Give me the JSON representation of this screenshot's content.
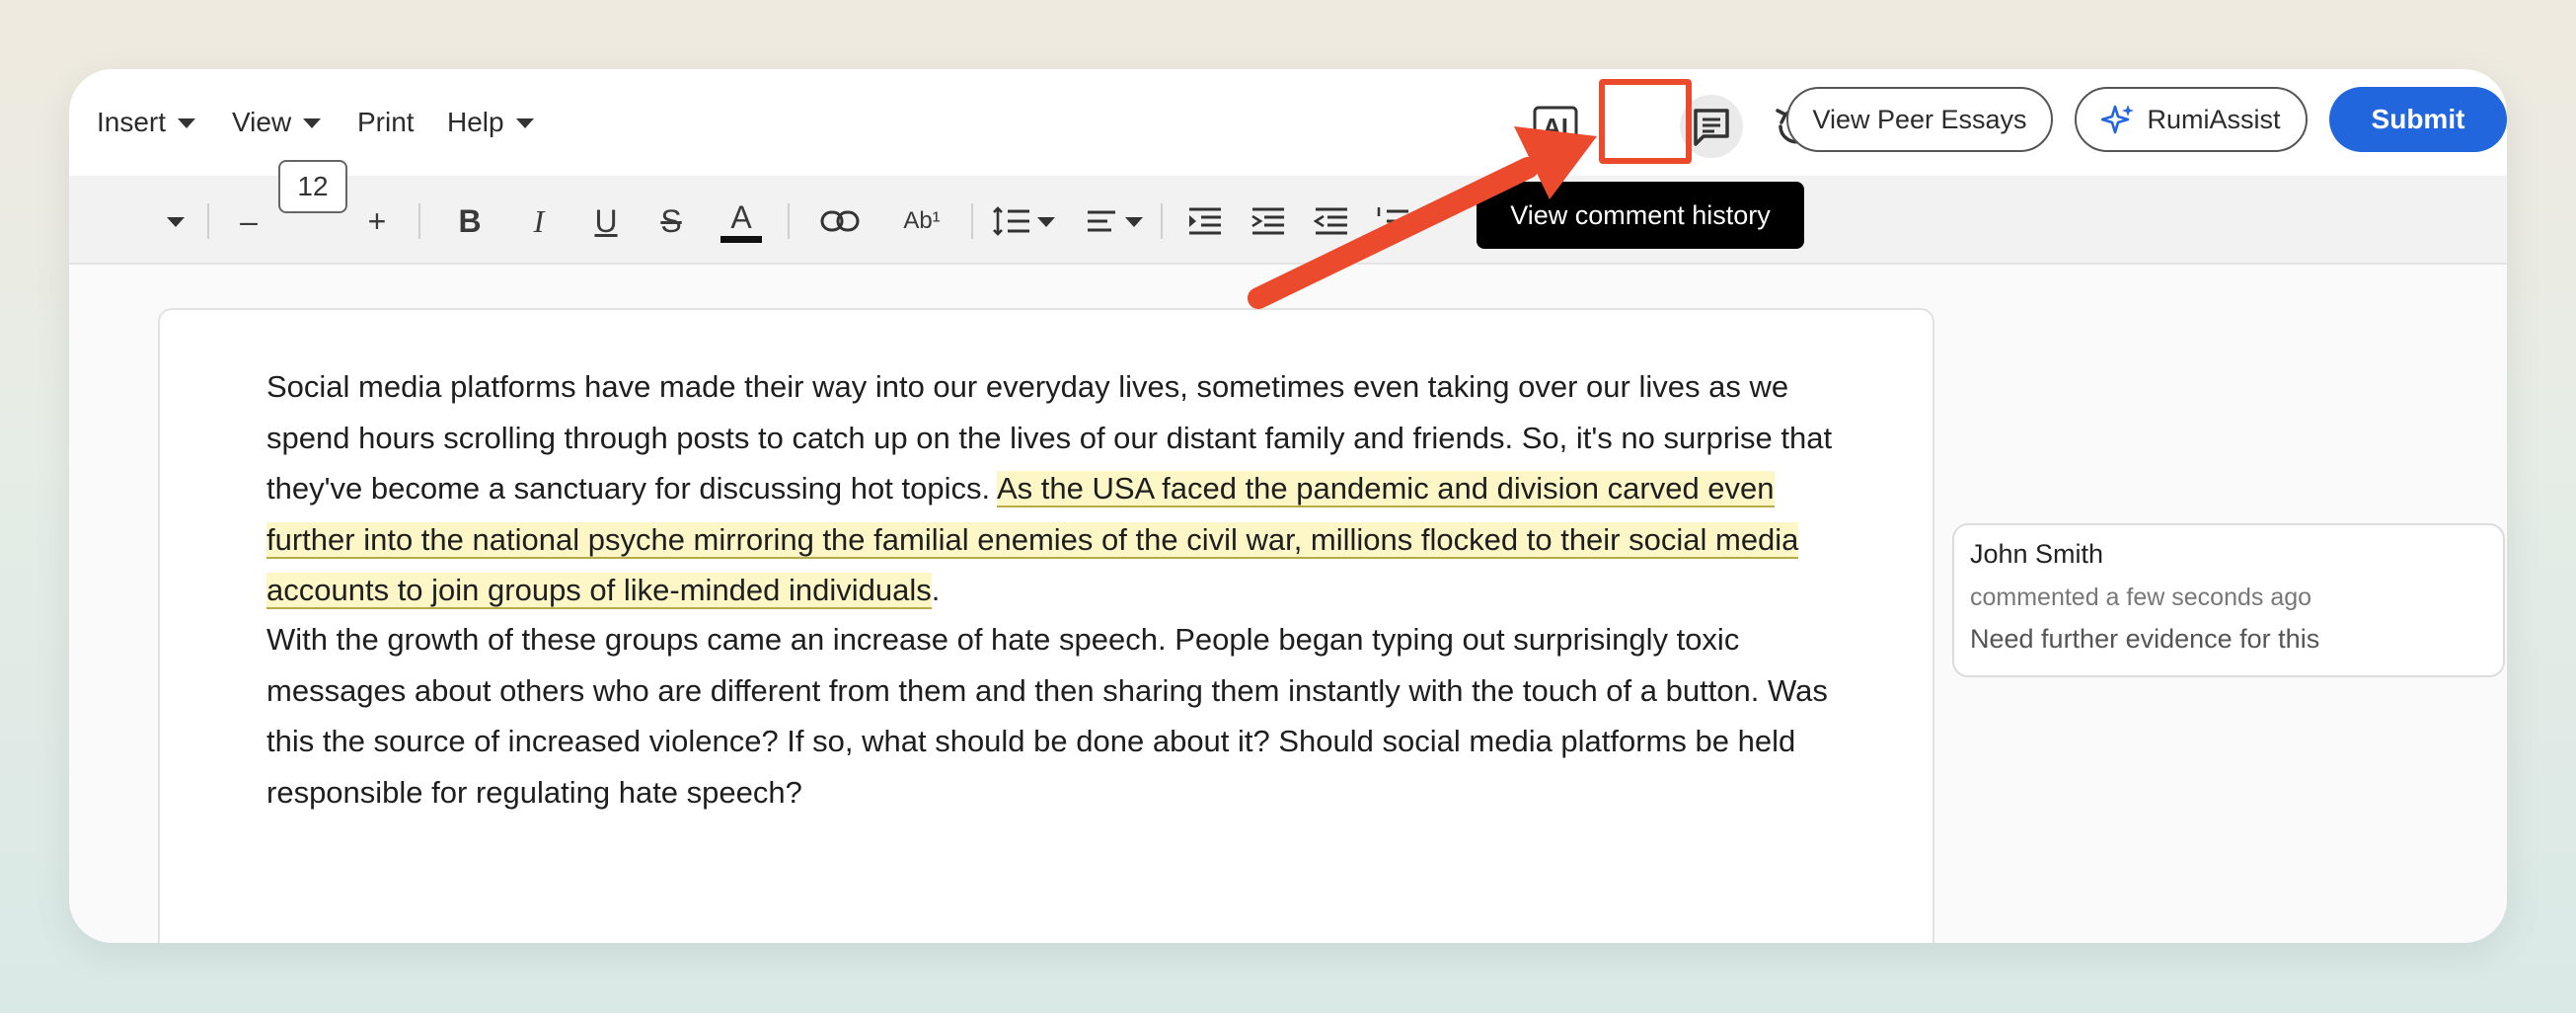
{
  "menu": {
    "insert": "Insert",
    "view": "View",
    "print": "Print",
    "help": "Help"
  },
  "header_actions": {
    "ai_label": "AI",
    "view_peer_essays": "View Peer Essays",
    "rumiassist": "RumiAssist",
    "submit": "Submit"
  },
  "toolbar": {
    "font_size": "12",
    "minus": "–",
    "plus": "+",
    "bold": "B",
    "italic": "I",
    "underline": "U",
    "strike": "S",
    "font_color": "A",
    "superscript": "Ab¹"
  },
  "tooltip": "View comment history",
  "document": {
    "p1_plain": "Social media platforms have made their way into our everyday lives, sometimes even taking over our lives as we spend hours scrolling through posts to catch up on the lives of our distant family and friends. So, it's no surprise that they've become a sanctuary for discussing hot topics. ",
    "p1_highlight": "As the USA faced the pandemic and division carved even further into the national psyche mirroring the familial enemies of the civil war, millions flocked to their social media accounts to join groups of like-minded individuals",
    "p1_end": ".",
    "p2": "With the growth of these groups came an increase of hate speech. People began typing out surprisingly toxic messages about others who are different from them and then sharing them instantly with the touch of a button. Was this the source of increased violence? If so, what should be done about it? Should social media platforms be held responsible for regulating hate speech?"
  },
  "comment": {
    "author": "John Smith",
    "time": "commented a few seconds ago",
    "text": "Need further evidence for this"
  },
  "colors": {
    "accent": "#2266dd",
    "annotation": "#ec4a2c",
    "highlight": "#fdf6c6"
  },
  "icons": [
    "ai-icon",
    "comment-icon",
    "history-icon",
    "sparkle-icon"
  ]
}
